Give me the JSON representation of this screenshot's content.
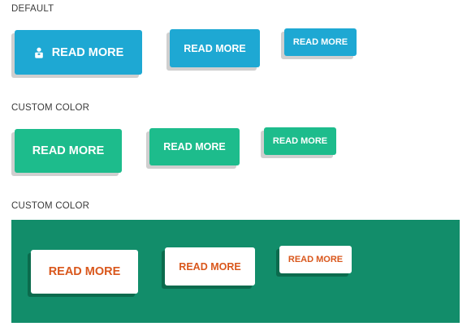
{
  "sections": {
    "default": {
      "label": "DEFAULT",
      "buttons": [
        {
          "label": "READ MORE",
          "icon": "person-icon"
        },
        {
          "label": "READ MORE"
        },
        {
          "label": "READ MORE"
        }
      ]
    },
    "custom_color_1": {
      "label": "CUSTOM COLOR",
      "buttons": [
        {
          "label": "READ MORE"
        },
        {
          "label": "READ MORE"
        },
        {
          "label": "READ MORE"
        }
      ]
    },
    "custom_color_2": {
      "label": "CUSTOM COLOR",
      "buttons": [
        {
          "label": "READ MORE"
        },
        {
          "label": "READ MORE"
        },
        {
          "label": "READ MORE"
        }
      ]
    }
  },
  "colors": {
    "blue": "#1ea8d3",
    "green": "#1dbc8c",
    "panel_green": "#128d6a",
    "orange_text": "#d9571c"
  }
}
